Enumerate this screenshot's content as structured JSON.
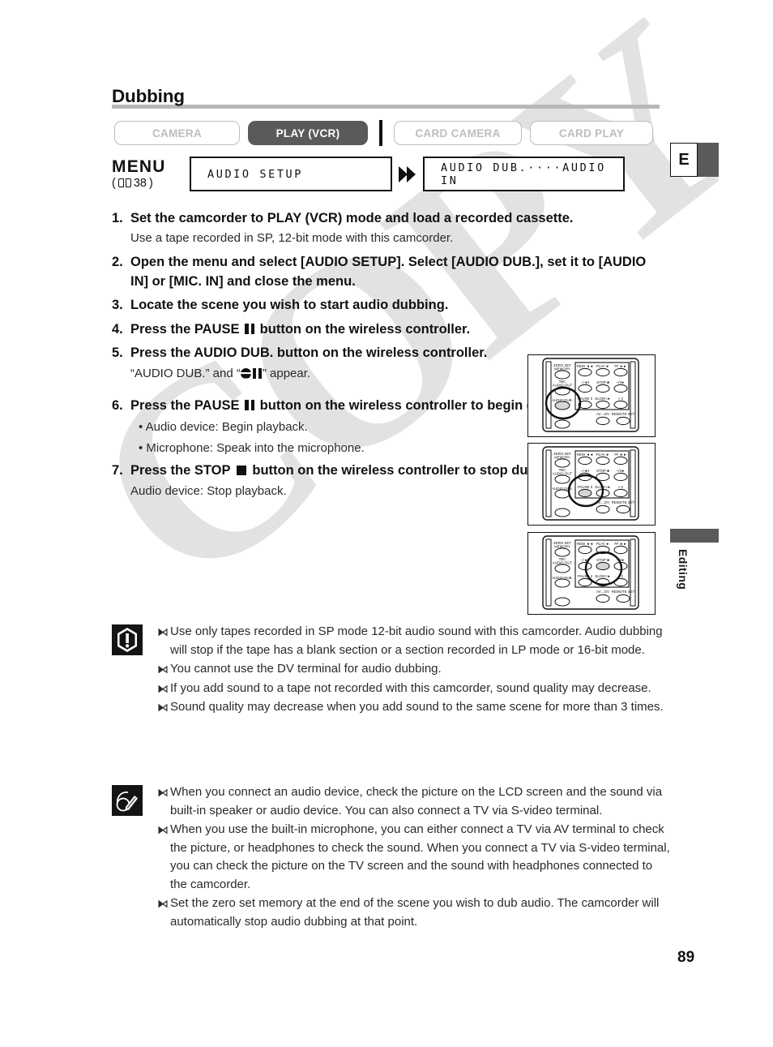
{
  "page": {
    "title": "Dubbing",
    "number": "89",
    "language_tab": "E",
    "section_tab": "Editing",
    "watermark": "COPY"
  },
  "modes": [
    {
      "label": "CAMERA",
      "state": "off"
    },
    {
      "label": "PLAY (VCR)",
      "state": "on"
    },
    {
      "label": "CARD CAMERA",
      "state": "off"
    },
    {
      "label": "CARD PLAY",
      "state": "off"
    }
  ],
  "menu": {
    "word": "MENU",
    "ref_open": "(",
    "ref_page": "38",
    "ref_close": ")",
    "book_icon": "book-icon",
    "arrow_icon": "double-chevron-right-icon",
    "box1": "AUDIO SETUP",
    "box2": "AUDIO DUB.····AUDIO IN"
  },
  "steps": [
    {
      "num": "1.",
      "text": "Set the camcorder to PLAY (VCR) mode and load a recorded cassette.",
      "note": "Use a tape recorded in SP, 12-bit mode with this camcorder."
    },
    {
      "num": "2.",
      "text": "Open the menu and select [AUDIO SETUP]. Select [AUDIO DUB.], set it to [AUDIO IN] or [MIC. IN] and close the menu."
    },
    {
      "num": "3.",
      "text": "Locate the scene you wish to start audio dubbing."
    },
    {
      "num": "4.",
      "text_before": "Press the PAUSE ",
      "glyph": "pause-icon",
      "text_after": " button on the wireless controller."
    },
    {
      "num": "5.",
      "text": "Press the AUDIO DUB. button on the wireless controller.",
      "note_before": "“AUDIO DUB.” and “",
      "note_glyph": "audio-dub-pause-icon",
      "note_after": "” appear."
    },
    {
      "num": "6.",
      "text_before": "Press the PAUSE ",
      "glyph": "pause-icon",
      "text_after": " button on the wireless controller to begin dubbing.",
      "bullets": [
        "• Audio device: Begin playback.",
        "• Microphone: Speak into the microphone."
      ]
    },
    {
      "num": "7.",
      "text_before": "Press the STOP ",
      "glyph": "stop-icon",
      "text_after": " button on the wireless controller to stop dubbing.",
      "note": "Audio device: Stop playback."
    }
  ],
  "remotes": [
    {
      "name": "remote-audio-dub",
      "highlight": "AUDIO DUB.",
      "labels_left": [
        "ZERO SET MEMORY",
        "TBC AUDIO OUT",
        "AUDIO DUB."
      ],
      "labels_grid": [
        "REW ◄◄",
        "PLAY ►",
        "FF ►►",
        "−/◄II",
        "STOP ■",
        "+/II►",
        "PAUSE II",
        "SLOW I►",
        "× 2"
      ],
      "labels_bottom": [
        "AV→DV",
        "REMOTE SET"
      ]
    },
    {
      "name": "remote-pause",
      "highlight": "PAUSE",
      "labels_left": [
        "ZERO SET MEMORY",
        "TBC AUDIO OUT",
        "AUDIO DUB."
      ],
      "labels_grid": [
        "REW ◄◄",
        "PLAY ►",
        "FF ►►",
        "−/◄II",
        "STOP ■",
        "+/II►",
        "PAUSE II",
        "SLOW I►",
        "× 2"
      ],
      "labels_bottom": [
        "AV→DV",
        "REMOTE SET"
      ]
    },
    {
      "name": "remote-stop",
      "highlight": "STOP",
      "labels_left": [
        "ZERO SET MEMORY",
        "TBC AUDIO OUT",
        "AUDIO DUB."
      ],
      "labels_grid": [
        "REW ◄◄",
        "PLAY ►",
        "FF ►►",
        "−/◄II",
        "STOP ■",
        "+/II►",
        "PAUSE II",
        "SLOW I►",
        "× 2"
      ],
      "labels_bottom": [
        "AV→DV",
        "REMOTE SET"
      ]
    }
  ],
  "notices": [
    {
      "icon": "warning-exclamation-icon",
      "items": [
        "Use only tapes recorded in SP mode 12-bit audio sound with this camcorder. Audio dubbing will stop if the tape has a blank section or a section recorded in LP mode or 16-bit mode.",
        "You cannot use the DV terminal for audio dubbing.",
        "If you add sound to a tape not recorded with this camcorder, sound quality may decrease.",
        "Sound quality may decrease when you add sound to the same scene for more than 3 times."
      ]
    },
    {
      "icon": "note-pencil-icon",
      "items": [
        "When you connect an audio device, check the picture on the LCD screen and the sound via built-in speaker or audio device. You can also connect a TV via S-video terminal.",
        "When you use the built-in microphone, you can either connect a TV via AV terminal to check the picture, or headphones to check the sound. When you connect a TV via S-video terminal, you can check the picture on the TV screen and the sound with headphones connected to the camcorder.",
        "Set the zero set memory at the end of the scene you wish to dub audio. The camcorder will automatically stop audio dubbing at that point."
      ]
    }
  ]
}
